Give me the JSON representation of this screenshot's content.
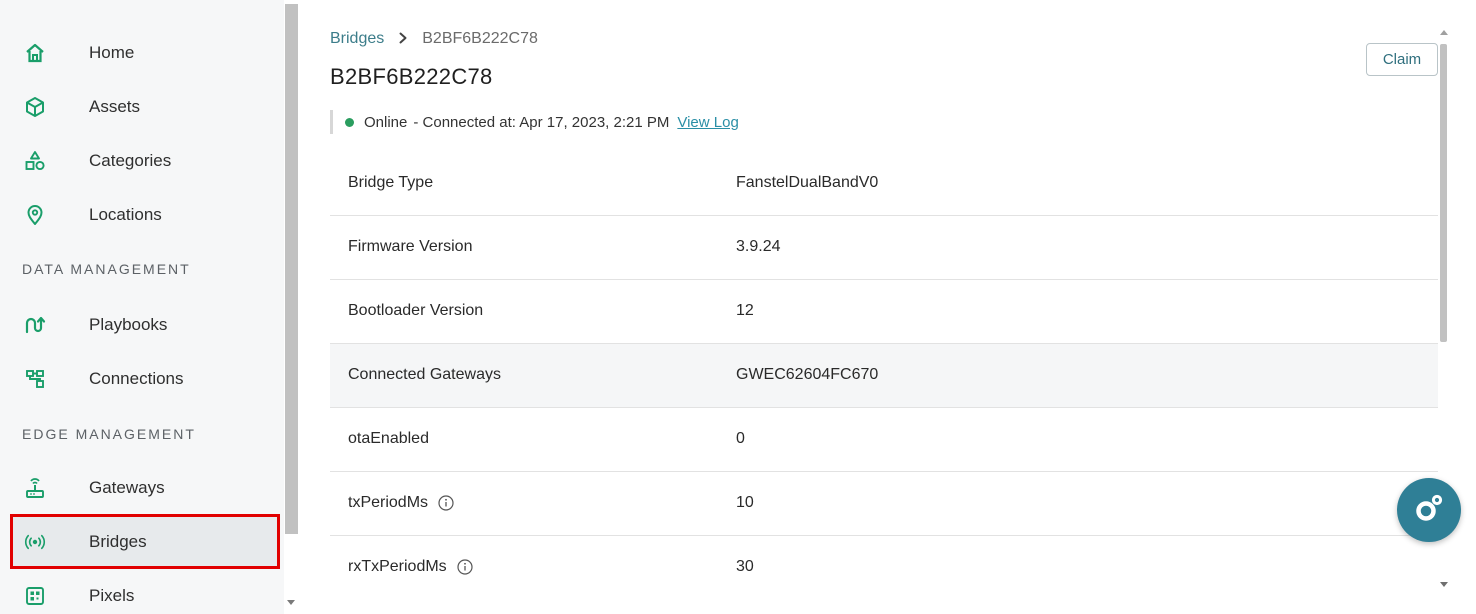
{
  "sidebar": {
    "items": [
      {
        "label": "Home",
        "icon": "home-icon"
      },
      {
        "label": "Assets",
        "icon": "cube-icon"
      },
      {
        "label": "Categories",
        "icon": "shapes-icon"
      },
      {
        "label": "Locations",
        "icon": "location-pin-icon"
      },
      {
        "label": "Playbooks",
        "icon": "playbook-icon"
      },
      {
        "label": "Connections",
        "icon": "connections-icon"
      },
      {
        "label": "Gateways",
        "icon": "gateway-icon"
      },
      {
        "label": "Bridges",
        "icon": "bridge-broadcast-icon"
      },
      {
        "label": "Pixels",
        "icon": "pixel-icon"
      }
    ],
    "sections": {
      "data_management": "DATA MANAGEMENT",
      "edge_management": "EDGE MANAGEMENT"
    },
    "active_item": "Bridges"
  },
  "breadcrumb": {
    "parent": "Bridges",
    "separator": "›",
    "current": "B2BF6B222C78"
  },
  "page_title": "B2BF6B222C78",
  "status": {
    "state": "Online",
    "connected_text": "- Connected at: Apr 17, 2023, 2:21 PM",
    "view_log": "View Log"
  },
  "claim_button": "Claim",
  "details": [
    {
      "key": "Bridge Type",
      "value": "FanstelDualBandV0",
      "info": false
    },
    {
      "key": "Firmware Version",
      "value": "3.9.24",
      "info": false
    },
    {
      "key": "Bootloader Version",
      "value": "12",
      "info": false
    },
    {
      "key": "Connected Gateways",
      "value": "GWEC62604FC670",
      "info": false
    },
    {
      "key": "otaEnabled",
      "value": "0",
      "info": false
    },
    {
      "key": "txPeriodMs",
      "value": "10",
      "info": true
    },
    {
      "key": "rxTxPeriodMs",
      "value": "30",
      "info": true
    }
  ],
  "colors": {
    "accent": "#3c7d8a",
    "online": "#2a9d5f",
    "highlight_border": "#e10000",
    "fab": "#2f7f96",
    "icon_green": "#1a9e6a"
  }
}
